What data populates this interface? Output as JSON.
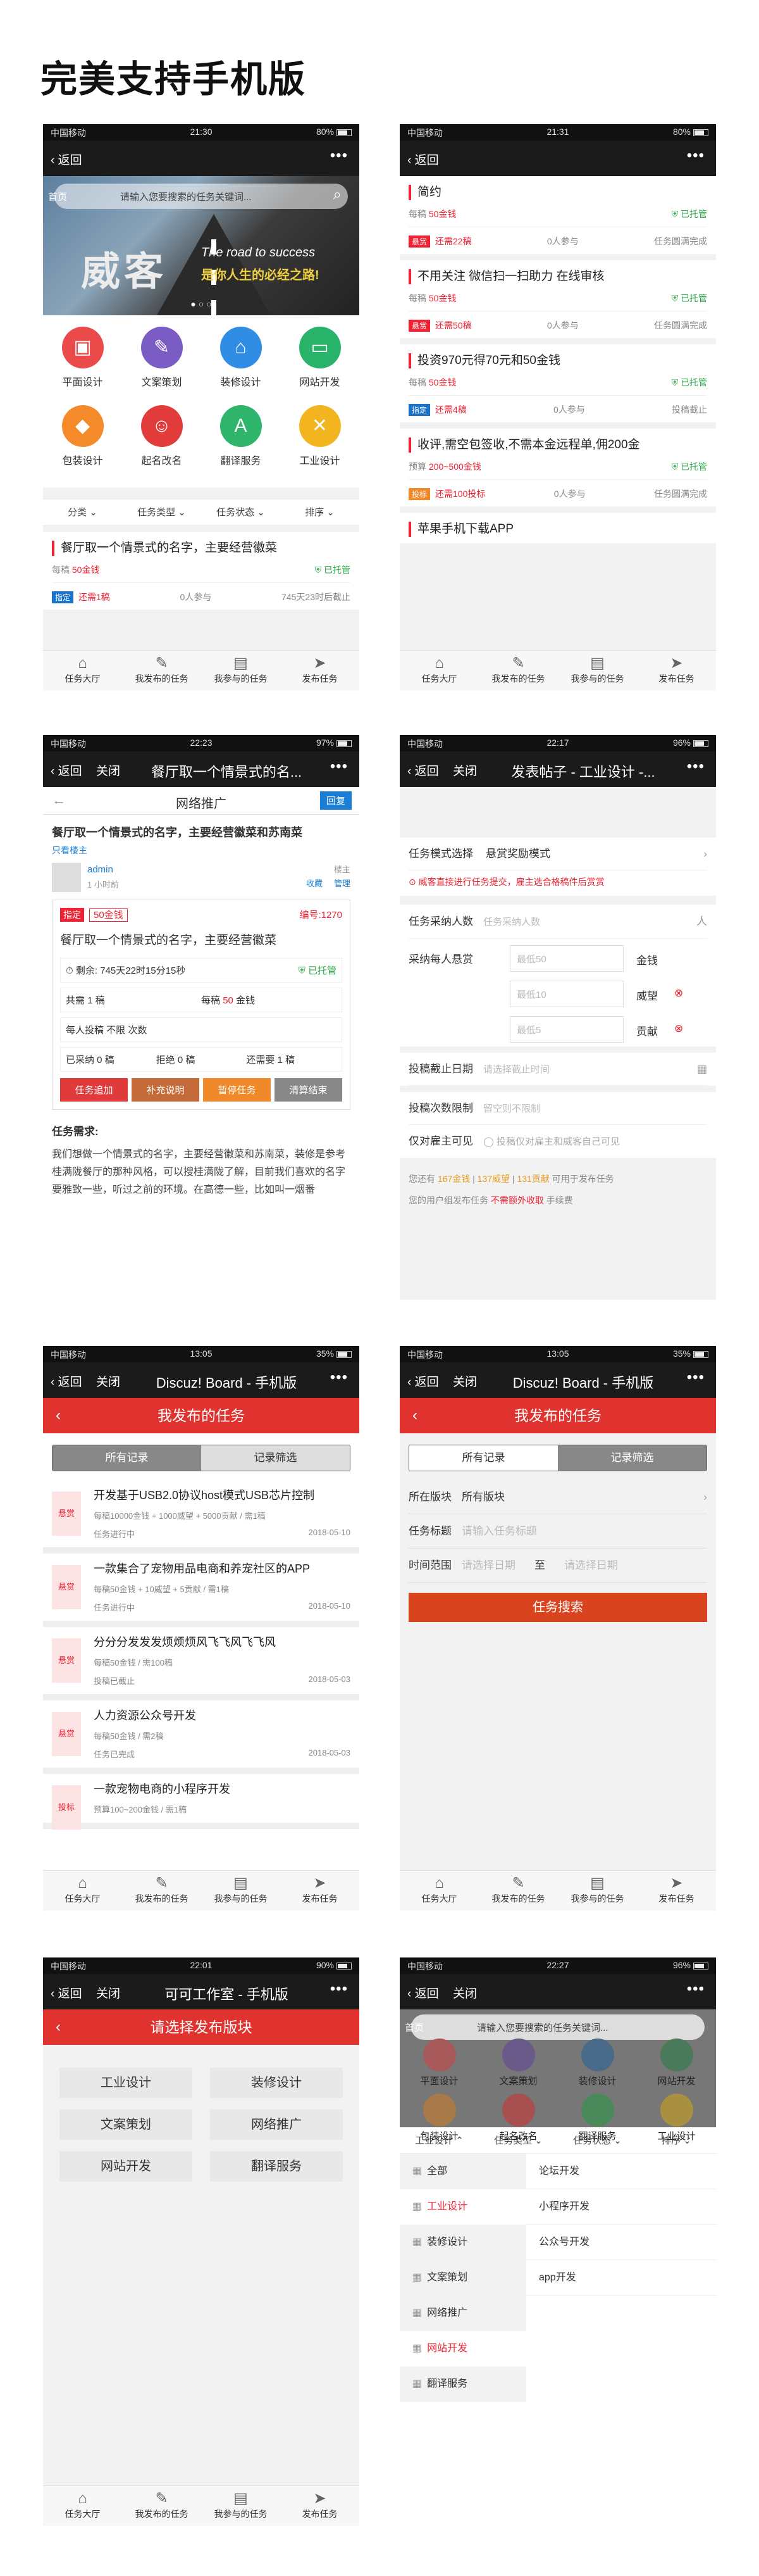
{
  "title": "完美支持手机版",
  "status": {
    "carrier": "中国移动",
    "p1_time": "21:30",
    "p1_bat": "80%",
    "p2_time": "21:31",
    "p2_bat": "80%",
    "p3_time": "22:23",
    "p3_bat": "97%",
    "p4_time": "22:17",
    "p4_bat": "96%",
    "p5_time": "13:05",
    "p5_bat": "35%",
    "p6_time": "13:05",
    "p6_bat": "35%",
    "p7_time": "22:01",
    "p7_bat": "90%",
    "p8_time": "22:27",
    "p8_bat": "96%"
  },
  "common": {
    "back": "返回",
    "close": "关闭",
    "more": "•••"
  },
  "tabbar": [
    "任务大厅",
    "我发布的任务",
    "我参与的任务",
    "发布任务"
  ],
  "p1": {
    "search_home": "首页",
    "search_ph": "请输入您要搜索的任务关键词...",
    "banner_big": "威客",
    "banner_en": "The road to success",
    "banner_cn": "是你人生的必经之路!",
    "icons": [
      "平面设计",
      "文案策划",
      "装修设计",
      "网站开发",
      "包装设计",
      "起名改名",
      "翻译服务",
      "工业设计"
    ],
    "filters": [
      "分类",
      "任务类型",
      "任务状态",
      "排序"
    ],
    "card": {
      "title": "餐厅取一个情景式的名字，主要经营徽菜",
      "price_label": "每稿",
      "price": "50金钱",
      "escrow": "已托管",
      "tag": "指定",
      "remain": "还需1稿",
      "join": "0人参与",
      "deadline": "745天23时后截止"
    }
  },
  "p2": {
    "items": [
      {
        "title": "简约",
        "price_label": "每稿",
        "price": "50金钱",
        "escrow": "已托管",
        "tag": "悬赏",
        "remain": "还需22稿",
        "join": "0人参与",
        "state": "任务圆满完成"
      },
      {
        "title": "不用关注 微信扫一扫助力 在线审核",
        "price_label": "每稿",
        "price": "50金钱",
        "escrow": "已托管",
        "tag": "悬赏",
        "remain": "还需50稿",
        "join": "0人参与",
        "state": "任务圆满完成"
      },
      {
        "title": "投资970元得70元和50金钱",
        "price_label": "每稿",
        "price": "50金钱",
        "escrow": "已托管",
        "tag": "指定",
        "remain": "还需4稿",
        "join": "0人参与",
        "state": "投稿截止"
      },
      {
        "title": "收评,需空包签收,不需本金远程单,佣200金",
        "price_label": "预算",
        "price": "200~500金钱",
        "escrow": "已托管",
        "tag": "投标",
        "remain": "还需100投标",
        "join": "0人参与",
        "state": "任务圆满完成"
      },
      {
        "title": "苹果手机下载APP"
      }
    ]
  },
  "p3": {
    "header_title": "餐厅取一个情景式的名...",
    "sub": "网络推广",
    "reply": "回复",
    "post_title": "餐厅取一个情景式的名字，主要经营徽菜和苏南菜",
    "only_author": "只看楼主",
    "user": "admin",
    "time": "1 小时前",
    "floor": "楼主",
    "fav": "收藏",
    "manage": "管理",
    "tag": "指定",
    "money": "50金钱",
    "number": "编号:1270",
    "task_title": "餐厅取一个情景式的名字，主要经营徽菜",
    "remain": "剩余: 745天22时15分15秒",
    "escrow": "已托管",
    "total": "共需 1 稿",
    "per": "每稿",
    "per_price": "50",
    "per_unit": "金钱",
    "limit": "每人投稿 不限 次数",
    "adopted": "已采纳 0 稿",
    "rejected": "拒绝 0 稿",
    "need": "还需要 1 稿",
    "btns": [
      "任务追加",
      "补充说明",
      "暂停任务",
      "清算结束"
    ],
    "req_label": "任务需求:",
    "req_text": "我们想做一个情景式的名字，主要经营徽菜和苏南菜，装修是参考桂满陇餐厅的那种风格，可以搜桂满陇了解，目前我们喜欢的名字要雅致一些，听过之前的环境。在高德一些，比如叫一烟番"
  },
  "p4": {
    "header_title": "发表帖子 - 工业设计 -...",
    "mode_label": "任务模式选择",
    "mode_val": "悬赏奖励模式",
    "tip": "威客直接进行任务提交，雇主选合格稿件后赏赏",
    "num_label": "任务采纳人数",
    "num_ph": "任务采纳人数",
    "unit_person": "人",
    "reward_label": "采纳每人悬赏",
    "r1": "最低50",
    "r1u": "金钱",
    "r2": "最低10",
    "r2u": "威望",
    "r3": "最低5",
    "r3u": "贡献",
    "deadline_label": "投稿截止日期",
    "deadline_ph": "请选择截止时间",
    "limit_label": "投稿次数限制",
    "limit_ph": "留空则不限制",
    "visible_label": "仅对雇主可见",
    "visible_txt": "投稿仅对雇主和威客自己可见",
    "bal1": "您还有",
    "gold": "167金钱",
    "weiwang": "137威望",
    "gongxian": "131贡献",
    "bal2": "可用于发布任务",
    "fee1": "您的用户组发布任务",
    "fee2": "不需额外收取",
    "fee3": "手续费"
  },
  "p5": {
    "header_title": "Discuz! Board - 手机版",
    "bar": "我发布的任务",
    "tabs": [
      "所有记录",
      "记录筛选"
    ],
    "items": [
      {
        "lt": "悬赏",
        "t": "开发基于USB2.0协议host模式USB芯片控制",
        "s": "每稿10000金钱 + 1000威望 + 5000贡献 / 需1稿",
        "state": "任务进行中",
        "date": "2018-05-10"
      },
      {
        "lt": "悬赏",
        "t": "一款集合了宠物用品电商和养宠社区的APP",
        "s": "每稿50金钱 + 10威望 + 5贡献 / 需1稿",
        "state": "任务进行中",
        "date": "2018-05-10"
      },
      {
        "lt": "悬赏",
        "t": "分分分发发发烦烦烦风飞飞风飞飞风",
        "s": "每稿50金钱 / 需100稿",
        "state": "投稿已截止",
        "date": "2018-05-03"
      },
      {
        "lt": "悬赏",
        "t": "人力资源公众号开发",
        "s": "每稿50金钱 / 需2稿",
        "state": "任务已完成",
        "date": "2018-05-03"
      },
      {
        "lt": "投标",
        "t": "一款宠物电商的小程序开发",
        "s": "预算100~200金钱 / 需1稿",
        "state": "",
        "date": ""
      }
    ]
  },
  "p6": {
    "header_title": "Discuz! Board - 手机版",
    "bar": "我发布的任务",
    "tabs": [
      "所有记录",
      "记录筛选"
    ],
    "section_label": "所在版块",
    "section_val": "所有版块",
    "title_label": "任务标题",
    "title_ph": "请输入任务标题",
    "time_label": "时间范围",
    "start_ph": "请选择日期",
    "to": "至",
    "end_ph": "请选择日期",
    "search_btn": "任务搜索"
  },
  "p7": {
    "header_title": "可可工作室 - 手机版",
    "bar": "请选择发布版块",
    "sections": [
      "工业设计",
      "装修设计",
      "文案策划",
      "网络推广",
      "网站开发",
      "翻译服务"
    ]
  },
  "p8": {
    "search_home": "首页",
    "search_ph": "请输入您要搜索的任务关键词...",
    "icons": [
      "平面设计",
      "文案策划",
      "装修设计",
      "网站开发",
      "包装设计",
      "起名改名",
      "翻译服务",
      "工业设计"
    ],
    "filters": [
      "工业设计",
      "任务类型",
      "任务状态",
      "排序"
    ],
    "left": [
      "全部",
      "工业设计",
      "装修设计",
      "文案策划",
      "网络推广",
      "网站开发",
      "翻译服务"
    ],
    "right": [
      "论坛开发",
      "小程序开发",
      "公众号开发",
      "app开发"
    ]
  },
  "colors": {
    "accent": "#e0322e",
    "green": "#2aa84a",
    "blue": "#1a73c8"
  }
}
